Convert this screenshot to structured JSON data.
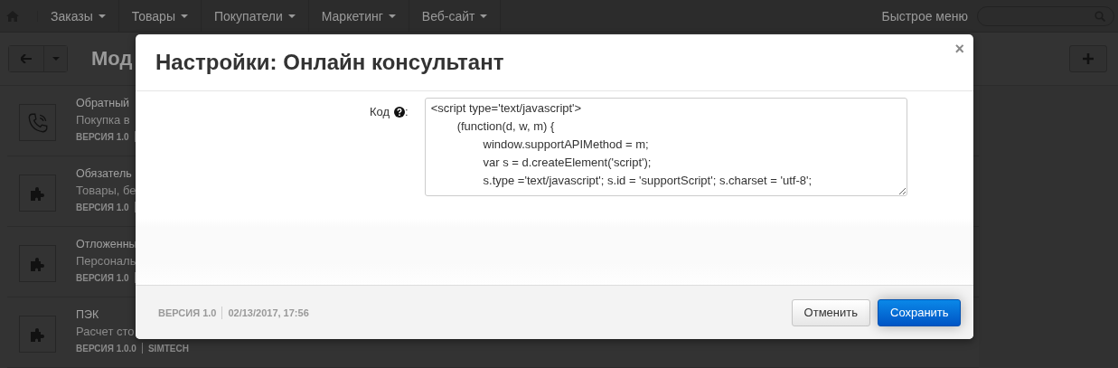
{
  "navbar": {
    "menu": [
      {
        "label": "Заказы"
      },
      {
        "label": "Товары"
      },
      {
        "label": "Покупатели"
      },
      {
        "label": "Маркетинг"
      },
      {
        "label": "Веб-сайт"
      }
    ],
    "quick_menu": "Быстрое меню"
  },
  "toolbar": {
    "title": "Мод"
  },
  "modules": [
    {
      "kind": "phone",
      "title": "Обратный",
      "description": "Покупка в",
      "version": "ВЕРСИЯ 1.0"
    },
    {
      "kind": "addon",
      "title": "Обязатель",
      "description": "Товары, бе",
      "version": "ВЕРСИЯ 1.0"
    },
    {
      "kind": "addon",
      "title": "Отложенны",
      "description": "Персональ",
      "version": "ВЕРСИЯ 1.0"
    },
    {
      "kind": "addon",
      "title": "ПЭК",
      "description": "Расчет сто",
      "version": "ВЕРСИЯ 1.0.0",
      "author": "SIMTECH"
    }
  ],
  "dialog": {
    "title": "Настройки: Онлайн консультант",
    "close": "×",
    "field_label": "Код",
    "label_suffix": ":",
    "code": "<script type='text/javascript'>\n\t(function(d, w, m) {\n\t\twindow.supportAPIMethod = m;\n\t\tvar s = d.createElement('script');\n\t\ts.type ='text/javascript'; s.id = 'supportScript'; s.charset = 'utf-8';",
    "version": "ВЕРСИЯ 1.0",
    "date": "02/13/2017, 17:56",
    "buttons": [
      {
        "kind": "cancel",
        "label": "Отменить"
      },
      {
        "kind": "primary",
        "label": "Сохранить"
      }
    ]
  }
}
